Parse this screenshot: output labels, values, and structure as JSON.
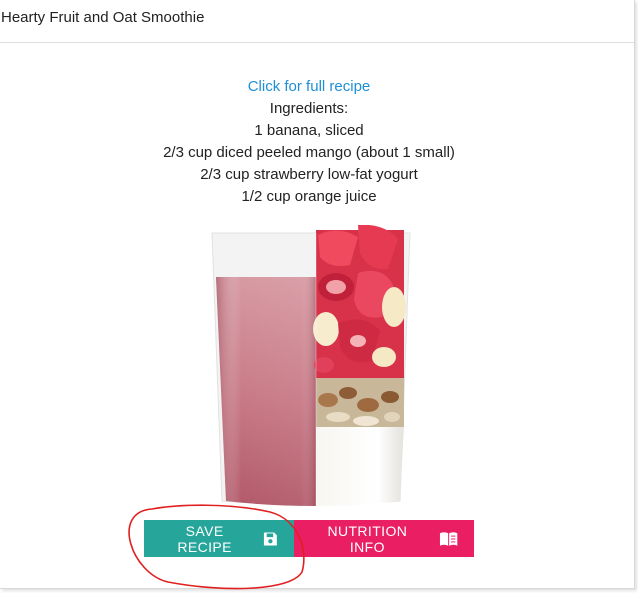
{
  "recipe": {
    "title": "Hearty Fruit and Oat Smoothie",
    "link_label": "Click for full recipe",
    "ingredients_heading": "Ingredients:",
    "ingredients": [
      "1 banana, sliced",
      "2/3 cup diced peeled mango (about 1 small)",
      "2/3 cup strawberry low-fat yogurt",
      "1/2 cup orange juice"
    ]
  },
  "buttons": {
    "save_label": "SAVE RECIPE",
    "save_icon": "floppy-disk-icon",
    "nutrition_label": "NUTRITION INFO",
    "nutrition_icon": "book-icon"
  },
  "colors": {
    "link": "#1f8fd6",
    "save_button": "#26a69a",
    "nutrition_button": "#e91e63",
    "annotation": "#e02020"
  }
}
